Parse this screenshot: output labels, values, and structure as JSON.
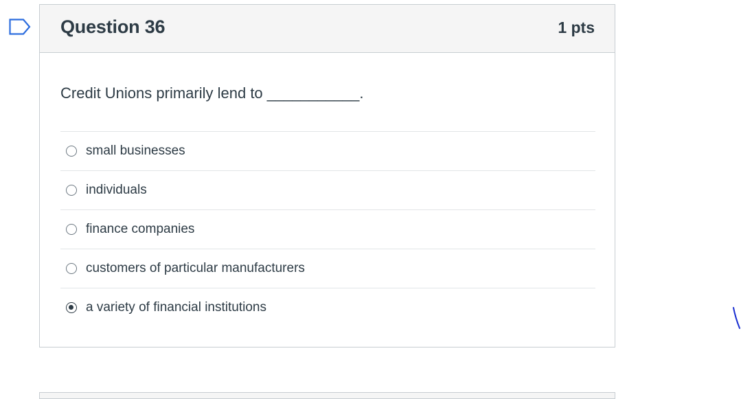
{
  "question": {
    "title": "Question 36",
    "points": "1 pts",
    "text": "Credit Unions primarily lend to ___________.",
    "answers": [
      {
        "label": "small businesses",
        "selected": false
      },
      {
        "label": "individuals",
        "selected": false
      },
      {
        "label": "finance companies",
        "selected": false
      },
      {
        "label": "customers of particular manufacturers",
        "selected": false
      },
      {
        "label": "a variety of financial institutions",
        "selected": true
      }
    ]
  },
  "icons": {
    "flag": "flag-icon",
    "radio": "radio-button"
  },
  "colors": {
    "text": "#2d3b45",
    "flag": "#2b6cde",
    "pen_mark": "#1a2fd1",
    "header_bg": "#f5f5f5",
    "border": "#c7cdd1"
  }
}
